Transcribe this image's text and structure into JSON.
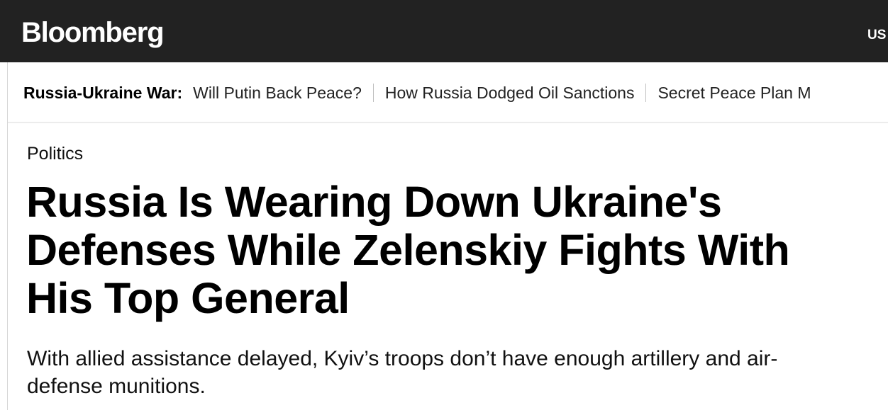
{
  "header": {
    "logo": "Bloomberg",
    "region": "US"
  },
  "topics": {
    "label": "Russia-Ukraine War:",
    "links": [
      "Will Putin Back Peace?",
      "How Russia Dodged Oil Sanctions",
      "Secret Peace Plan M"
    ]
  },
  "article": {
    "category": "Politics",
    "headline": "Russia Is Wearing Down Ukraine's\nDefenses While Zelenskiy Fights With\nHis Top General",
    "dek": "With allied assistance delayed, Kyiv’s troops don’t have enough artillery and air-\ndefense munitions."
  },
  "colors": {
    "header_bg": "#222222",
    "header_text": "#ffffff",
    "body_text": "#000000",
    "divider": "#bfbfbf"
  }
}
